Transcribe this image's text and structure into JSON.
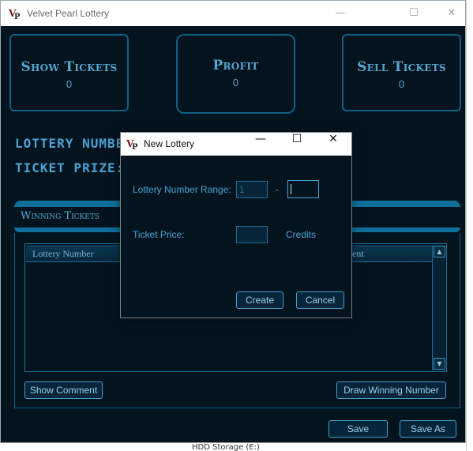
{
  "window": {
    "title": "Velvet Pearl Lottery",
    "controls": {
      "minimize": "—",
      "maximize": "☐",
      "close": "✕"
    }
  },
  "cards": {
    "show_tickets": {
      "label": "Show Tickets",
      "value": "0"
    },
    "profit": {
      "label": "Profit",
      "value": "0"
    },
    "sell_tickets": {
      "label": "Sell Tickets",
      "value": "0"
    }
  },
  "labels": {
    "lottery_number": "LOTTERY NUMBER",
    "ticket_prize": "TICKET PRIZE:"
  },
  "winning_panel": {
    "title": "Winning Tickets",
    "columns": [
      "Lottery Number",
      "ent"
    ],
    "show_comment": "Show Comment",
    "draw_winning_number": "Draw Winning Number"
  },
  "footer": {
    "save": "Save",
    "save_as": "Save As"
  },
  "dialog": {
    "title": "New Lottery",
    "controls": {
      "minimize": "—",
      "maximize": "☐",
      "close": "✕"
    },
    "range_label": "Lottery Number Range:",
    "range_from": "1",
    "range_sep": "-",
    "range_to": "",
    "price_label": "Ticket Price:",
    "price_value": "",
    "price_unit": "Credits",
    "create": "Create",
    "cancel": "Cancel"
  },
  "background": {
    "bottom_text": "HDD Storage (E:)"
  },
  "colors": {
    "window_bg": "#03141f",
    "accent": "#4aa2d2",
    "border": "#0e5f86"
  }
}
